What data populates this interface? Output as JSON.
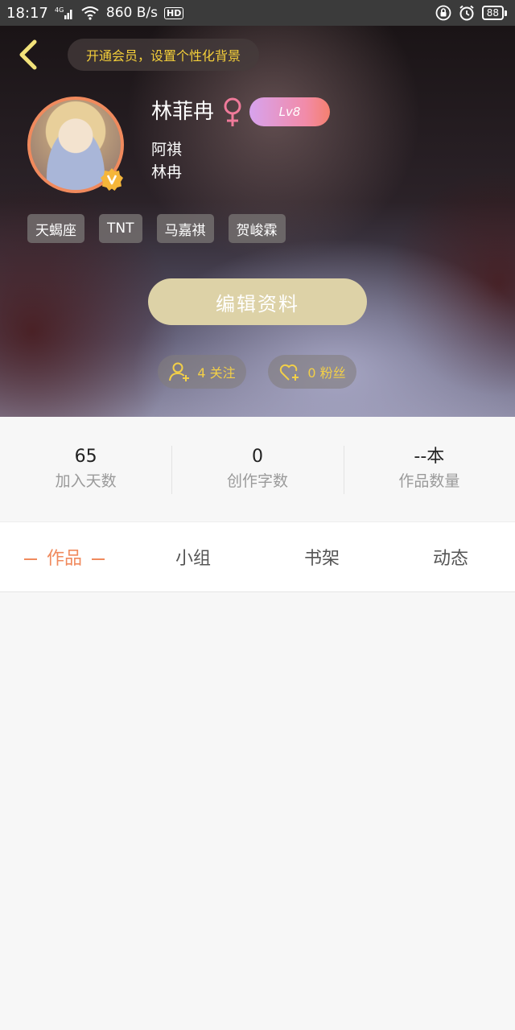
{
  "status_bar": {
    "time": "18:17",
    "network_type": "4G",
    "speed": "860 B/s",
    "hd_label": "HD",
    "battery": "88",
    "icons": [
      "signal-icon",
      "wifi-icon",
      "lock-icon",
      "alarm-icon",
      "battery-icon"
    ]
  },
  "header": {
    "vip_prompt": "开通会员，设置个性化背景",
    "username": "林菲冉",
    "gender_symbol": "♀",
    "level": "Lv8",
    "bio_lines": [
      "阿祺",
      "林冉"
    ],
    "tags": [
      "天蝎座",
      "TNT",
      "马嘉祺",
      "贺峻霖"
    ],
    "edit_button": "编辑资料",
    "following": "4 关注",
    "fans": "0 粉丝",
    "colors": {
      "accent": "#f08a5d",
      "gold": "#f2cf48",
      "edit_button_bg": "#ddd2a7"
    }
  },
  "stats": [
    {
      "value": "65",
      "label": "加入天数"
    },
    {
      "value": "0",
      "label": "创作字数"
    },
    {
      "value": "--本",
      "label": "作品数量"
    }
  ],
  "tabs": [
    {
      "label": "作品",
      "active": true
    },
    {
      "label": "小组",
      "active": false
    },
    {
      "label": "书架",
      "active": false
    },
    {
      "label": "动态",
      "active": false
    }
  ]
}
